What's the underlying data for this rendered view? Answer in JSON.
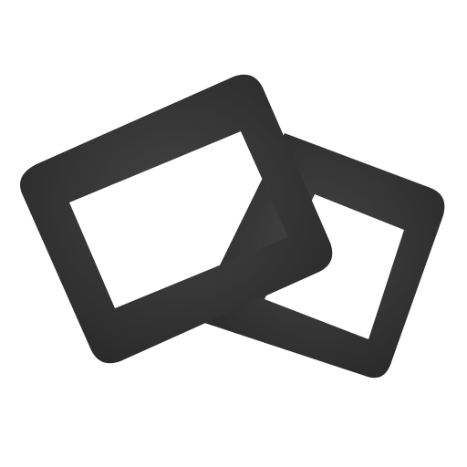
{
  "icon": {
    "name": "photo-slides-icon",
    "fill_color": "#2f2f2f",
    "highlight_color": "#444444",
    "window_color": "#ffffff",
    "background_color": "#ffffff"
  }
}
